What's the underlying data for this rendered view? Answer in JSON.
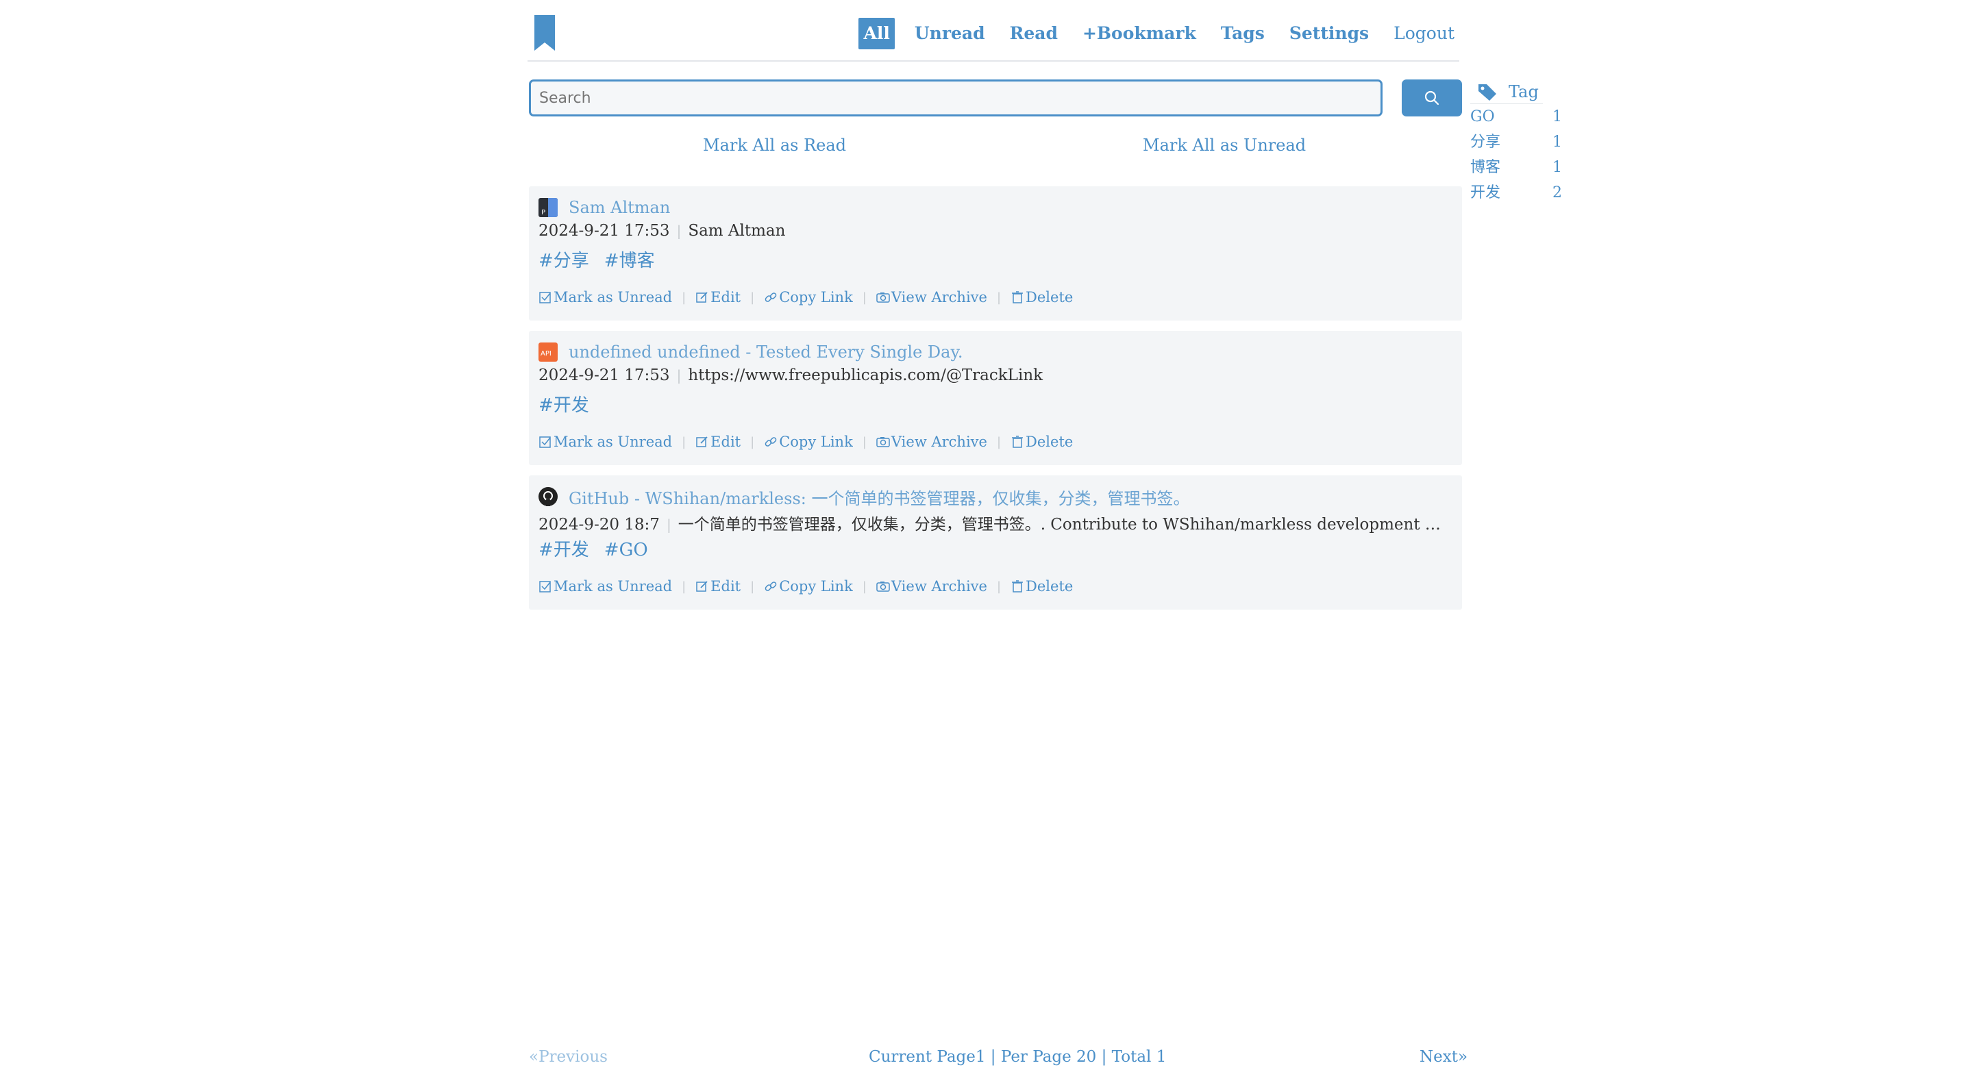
{
  "nav": {
    "all": "All",
    "unread": "Unread",
    "read": "Read",
    "bookmark": "+Bookmark",
    "tags": "Tags",
    "settings": "Settings",
    "logout": "Logout"
  },
  "search": {
    "placeholder": "Search",
    "icon": "search-icon"
  },
  "bulk": {
    "mark_all_read": "Mark All as Read",
    "mark_all_unread": "Mark All as Unread"
  },
  "actions": {
    "mark_unread": "Mark as Unread",
    "edit": "Edit",
    "copy_link": "Copy Link",
    "view_archive": "View Archive",
    "delete": "Delete"
  },
  "bookmarks": [
    {
      "title": "Sam Altman",
      "date": "2024-9-21 17:53",
      "desc": "Sam Altman",
      "tags": [
        "#分享",
        "#博客"
      ]
    },
    {
      "title": "undefined undefined - Tested Every Single Day.",
      "date": "2024-9-21 17:53",
      "desc": "https://www.freepublicapis.com/@TrackLink",
      "tags": [
        "#开发"
      ]
    },
    {
      "title": "GitHub - WShihan/markless: 一个简单的书签管理器，仅收集，分类，管理书签。",
      "date": "2024-9-20 18:7",
      "desc": "一个简单的书签管理器，仅收集，分类，管理书签。. Contribute to WShihan/markless development …",
      "tags": [
        "#开发",
        "#GO"
      ]
    }
  ],
  "tag_panel": {
    "heading": "Tag",
    "tags": [
      {
        "name": "GO",
        "count": "1"
      },
      {
        "name": "分享",
        "count": "1"
      },
      {
        "name": "博客",
        "count": "1"
      },
      {
        "name": "开发",
        "count": "2"
      }
    ]
  },
  "pagination": {
    "prev": "«Previous",
    "info": "Current Page1 | Per Page 20 | Total 1",
    "next": "Next»"
  },
  "colors": {
    "accent": "#4a90c8",
    "card_bg": "#f3f5f7"
  }
}
